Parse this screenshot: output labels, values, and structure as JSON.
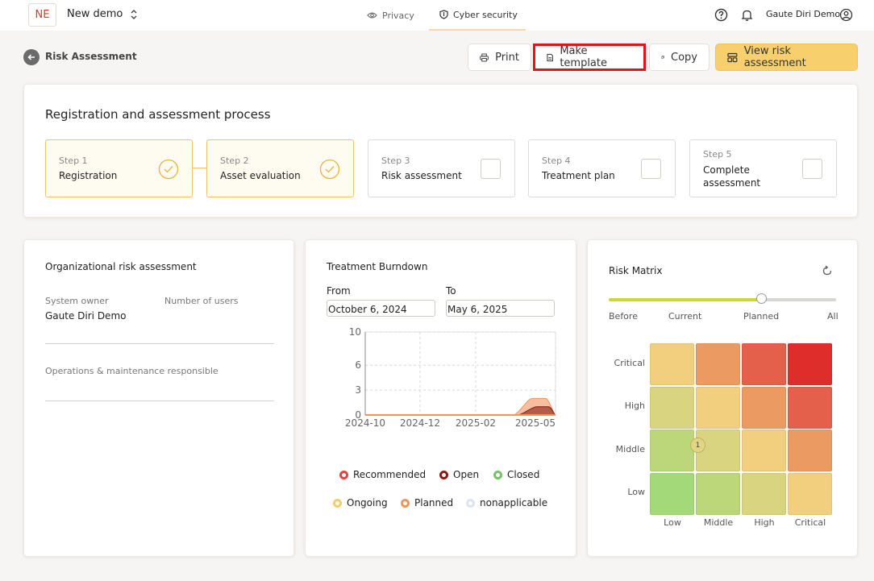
{
  "workspace": {
    "initials": "NE",
    "name": "New demo"
  },
  "nav": {
    "privacy": "Privacy",
    "cyber": "Cyber security"
  },
  "user": {
    "name": "Gaute Diri Demo"
  },
  "page": {
    "title": "Risk Assessment"
  },
  "toolbar": {
    "print": "Print",
    "make_template": "Make template",
    "copy": "Copy",
    "view": "View risk assessment"
  },
  "process": {
    "title": "Registration and assessment process",
    "steps": [
      {
        "num": "Step 1",
        "label": "Registration",
        "done": true
      },
      {
        "num": "Step 2",
        "label": "Asset evaluation",
        "done": true
      },
      {
        "num": "Step 3",
        "label": "Risk assessment",
        "done": false
      },
      {
        "num": "Step 4",
        "label": "Treatment plan",
        "done": false
      },
      {
        "num": "Step 5",
        "label": "Complete assessment",
        "done": false
      }
    ]
  },
  "org": {
    "title": "Organizational risk assessment",
    "system_owner_label": "System owner",
    "system_owner_value": "Gaute Diri Demo",
    "users_label": "Number of users",
    "ops_label": "Operations & maintenance responsible"
  },
  "burndown": {
    "title": "Treatment Burndown",
    "from_label": "From",
    "from_value": "October 6, 2024",
    "to_label": "To",
    "to_value": "May 6, 2025",
    "legend": [
      {
        "name": "Recommended",
        "color": "#e0453f"
      },
      {
        "name": "Open",
        "color": "#8a1c14"
      },
      {
        "name": "Closed",
        "color": "#7ac06a"
      },
      {
        "name": "Ongoing",
        "color": "#f3cd6b"
      },
      {
        "name": "Planned",
        "color": "#f0955f"
      },
      {
        "name": "nonapplicable",
        "color": "#dbe5ef"
      }
    ]
  },
  "chart_data": {
    "type": "area",
    "x": [
      "2024-10",
      "2024-12",
      "2025-02",
      "2025-05"
    ],
    "yticks": [
      0,
      3,
      6,
      10
    ],
    "ylim": [
      0,
      10
    ],
    "xlim": [
      "2024-10-06",
      "2025-05-06"
    ],
    "grid": true,
    "series": [
      {
        "name": "Planned",
        "x": [
          "2025-03-20",
          "2025-04-10",
          "2025-04-25",
          "2025-05-06"
        ],
        "values": [
          0,
          2,
          2,
          0
        ],
        "color": "#f0955f"
      },
      {
        "name": "Open",
        "x": [
          "2025-03-25",
          "2025-04-15",
          "2025-04-28",
          "2025-05-06"
        ],
        "values": [
          0,
          1,
          1,
          0
        ],
        "color": "#8a1c14"
      }
    ]
  },
  "matrix": {
    "title": "Risk Matrix",
    "slider_labels": [
      "Before",
      "Current",
      "Planned",
      "All"
    ],
    "slider_value": "Planned",
    "rows": [
      "Critical",
      "High",
      "Middle",
      "Low"
    ],
    "cols": [
      "Low",
      "Middle",
      "High",
      "Critical"
    ],
    "colors": [
      [
        "#f2cf7e",
        "#eb9a62",
        "#e4604a",
        "#dd2e2c"
      ],
      [
        "#d9d47f",
        "#f2cf7e",
        "#eb9a62",
        "#e4604a"
      ],
      [
        "#bcd67a",
        "#d9d47f",
        "#f2cf7e",
        "#eb9a62"
      ],
      [
        "#a4d97a",
        "#bcd67a",
        "#d9d47f",
        "#f2cf7e"
      ]
    ],
    "marker": {
      "row": "Middle",
      "col": "Low",
      "count": "1"
    }
  }
}
